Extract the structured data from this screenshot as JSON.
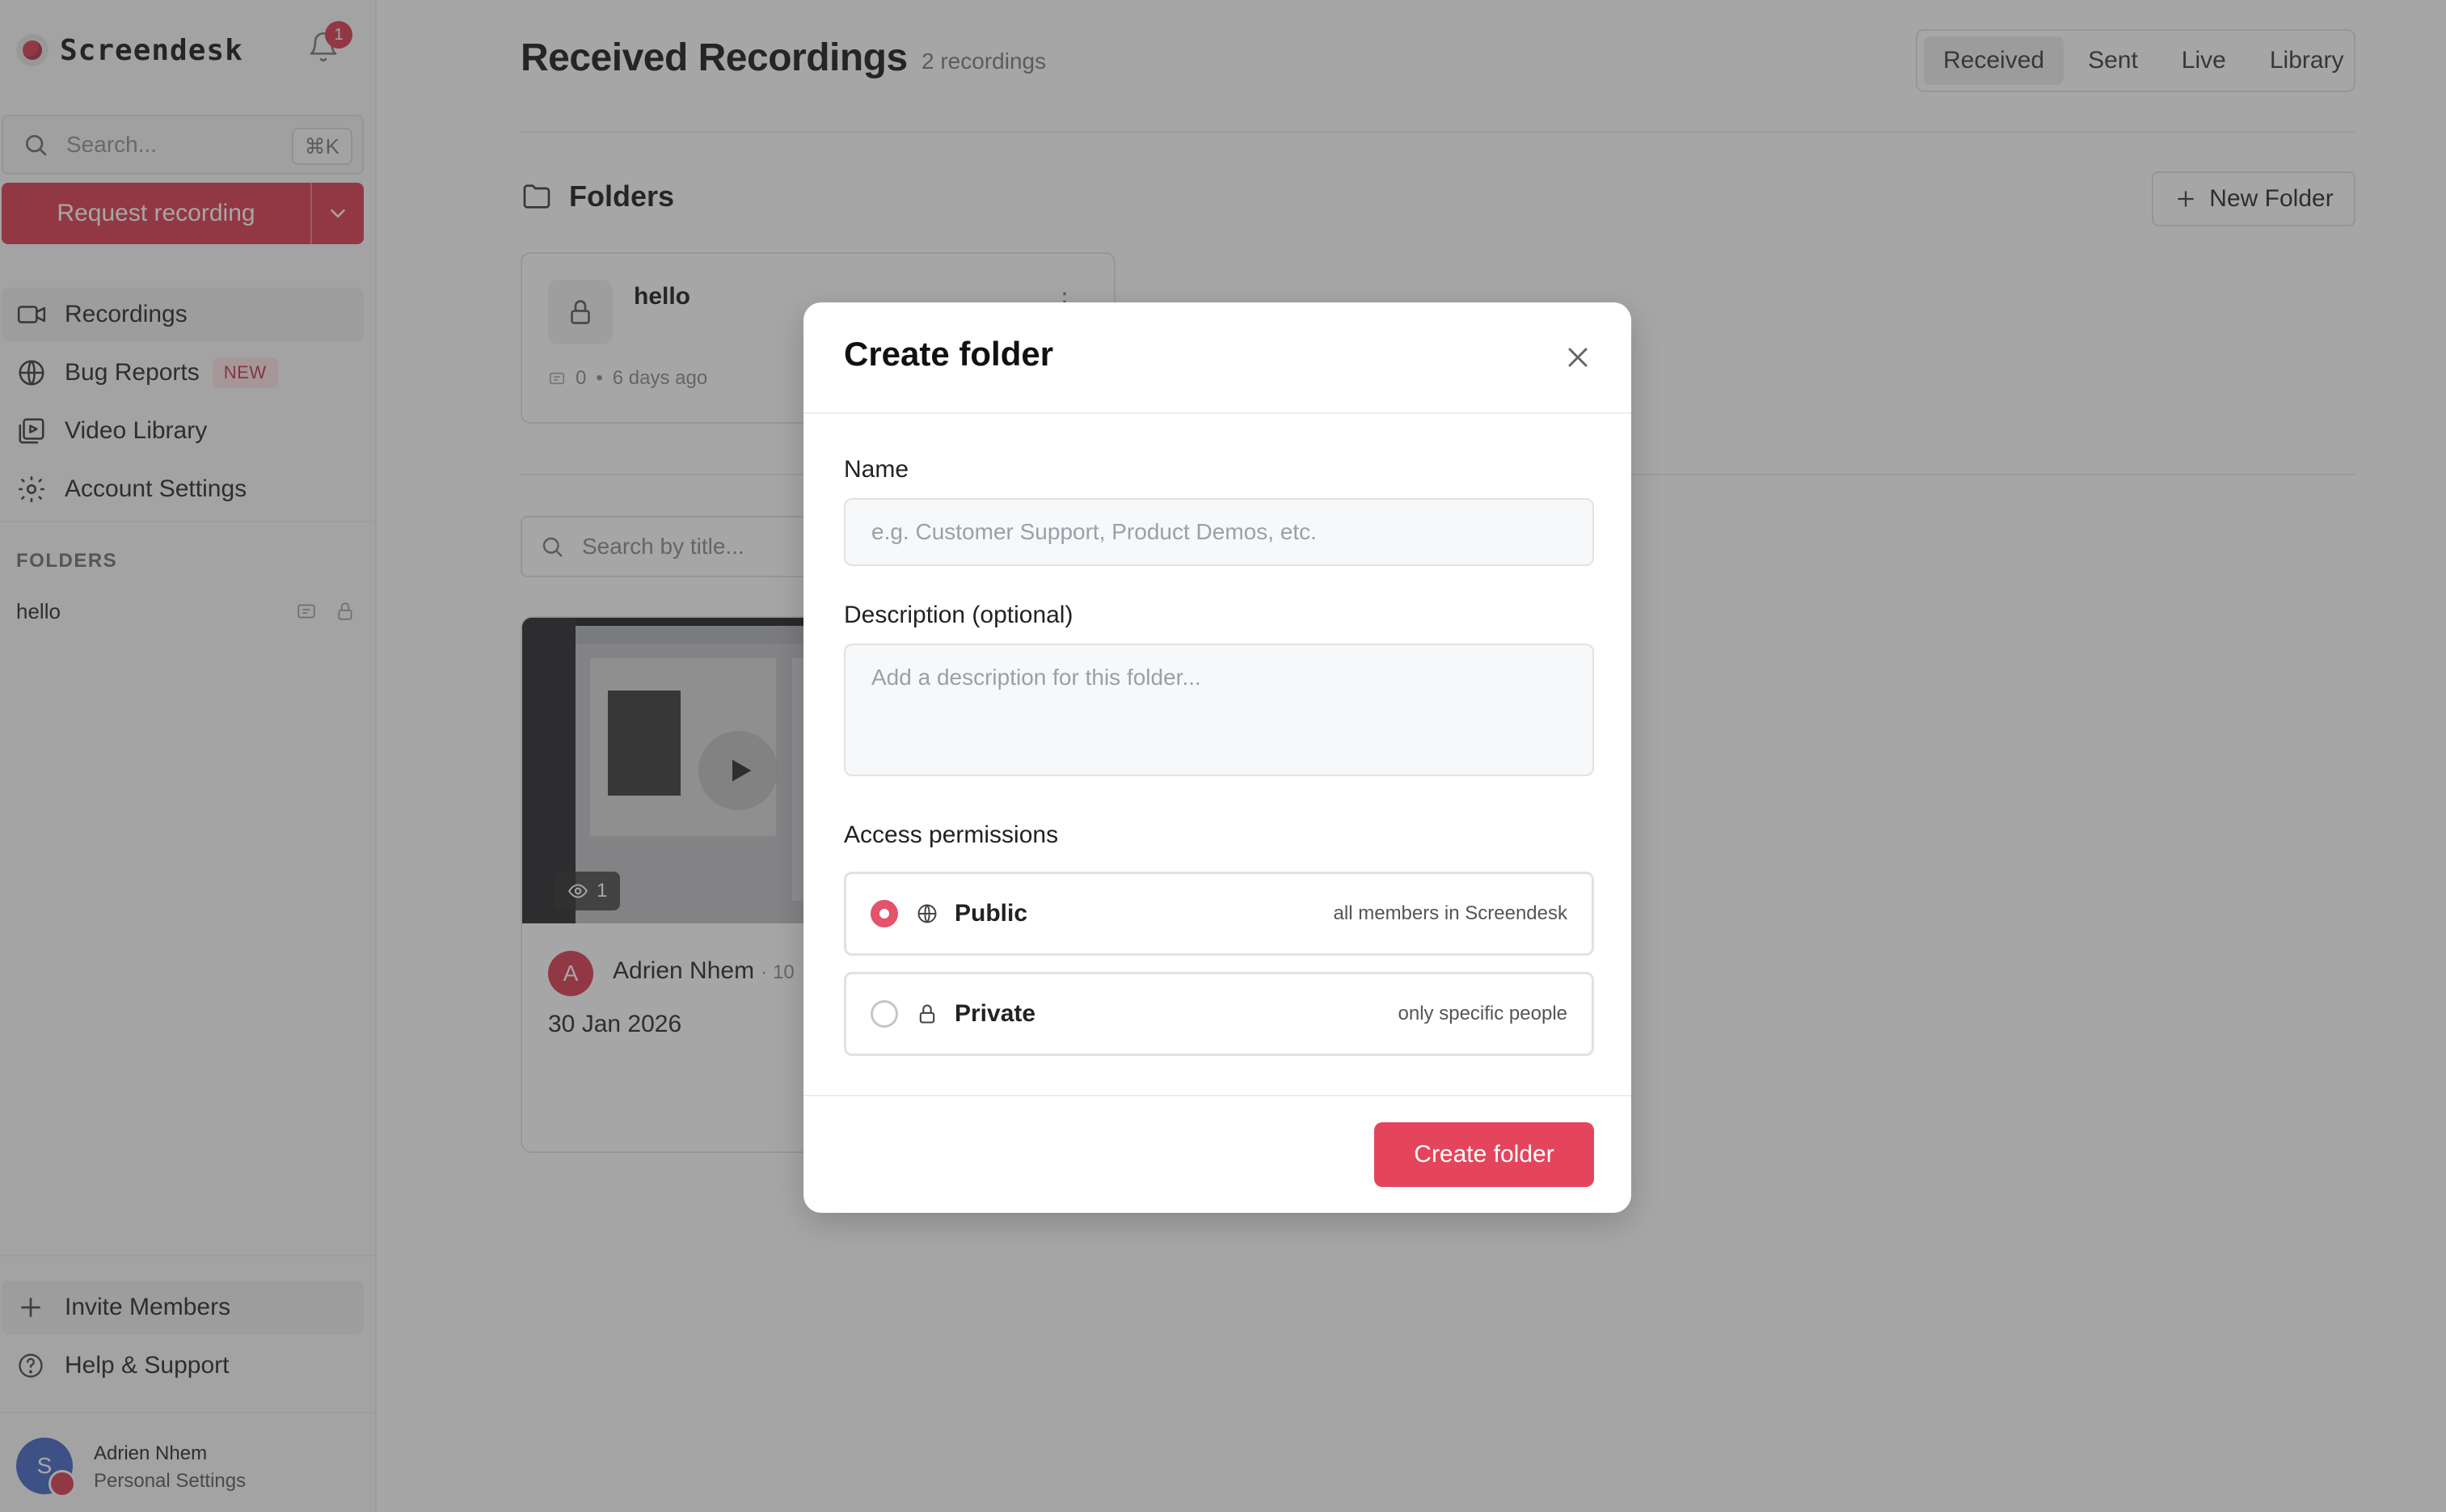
{
  "app": {
    "name": "Screendesk",
    "notifications_count": "1"
  },
  "sidebar": {
    "search_placeholder": "Search...",
    "search_shortcut": "⌘K",
    "request_button": "Request recording",
    "nav": [
      {
        "label": "Recordings",
        "icon": "video-icon",
        "active": true
      },
      {
        "label": "Bug Reports",
        "icon": "bug-icon",
        "badge": "NEW"
      },
      {
        "label": "Video Library",
        "icon": "library-icon"
      },
      {
        "label": "Account Settings",
        "icon": "gear-icon"
      }
    ],
    "folders_title": "FOLDERS",
    "folders": [
      {
        "name": "hello"
      }
    ],
    "invite_label": "Invite Members",
    "help_label": "Help & Support",
    "user": {
      "initial": "S",
      "name": "Adrien Nhem",
      "subtitle": "Personal Settings"
    }
  },
  "main": {
    "title": "Received Recordings",
    "count": "2 recordings",
    "tabs": [
      {
        "label": "Received",
        "active": true
      },
      {
        "label": "Sent"
      },
      {
        "label": "Live"
      },
      {
        "label": "Library"
      }
    ],
    "folders_heading": "Folders",
    "new_folder_label": "New Folder",
    "folder_card": {
      "name": "hello",
      "count": "0",
      "age": "6 days ago",
      "menu": "⋮"
    },
    "title_search_placeholder": "Search by title...",
    "recording": {
      "views": "1",
      "author_initial": "A",
      "author": "Adrien Nhem",
      "author_suffix": "· 10",
      "date": "30 Jan 2026"
    }
  },
  "modal": {
    "title": "Create folder",
    "name_label": "Name",
    "name_placeholder": "e.g. Customer Support, Product Demos, etc.",
    "description_label": "Description (optional)",
    "description_placeholder": "Add a description for this folder...",
    "access_label": "Access permissions",
    "options": [
      {
        "label": "Public",
        "description": "all members in Screendesk",
        "selected": true,
        "icon": "globe-icon"
      },
      {
        "label": "Private",
        "description": "only specific people",
        "selected": false,
        "icon": "lock-icon"
      }
    ],
    "submit_label": "Create folder"
  },
  "colors": {
    "accent": "#d8344a",
    "accent_button": "#e4455c",
    "scrim": "rgba(60,60,60,0.46)"
  }
}
